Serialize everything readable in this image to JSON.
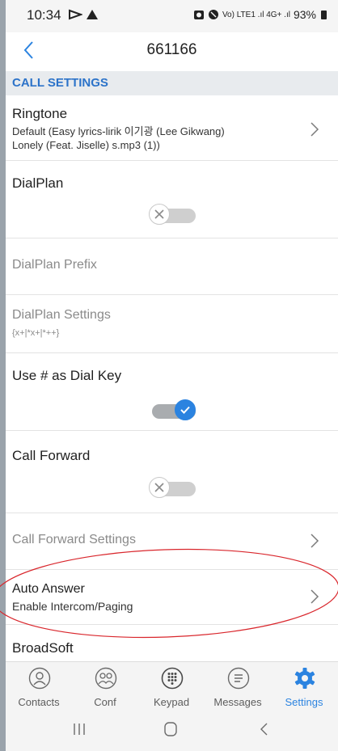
{
  "status_bar": {
    "time": "10:34",
    "right_text": "Vo) LTE1 .ıl 4G+ .ıl",
    "battery": "93%"
  },
  "header": {
    "title": "661166"
  },
  "section": {
    "title": "CALL SETTINGS"
  },
  "settings": {
    "ringtone": {
      "title": "Ringtone",
      "subtitle_line1": "Default (Easy lyrics-lirik 이기광 (Lee Gikwang)",
      "subtitle_line2": "Lonely (Feat. Jiselle) s.mp3 (1))"
    },
    "dialplan": {
      "title": "DialPlan",
      "enabled": false
    },
    "dialplan_prefix": {
      "title": "DialPlan Prefix"
    },
    "dialplan_settings": {
      "title": "DialPlan Settings",
      "value": "{x+|*x+|*++}"
    },
    "use_hash": {
      "title": "Use # as Dial Key",
      "enabled": true
    },
    "call_forward": {
      "title": "Call Forward",
      "enabled": false
    },
    "call_forward_settings": {
      "title": "Call Forward Settings"
    },
    "auto_answer": {
      "title": "Auto Answer",
      "subtitle": "Enable Intercom/Paging"
    },
    "broadsoft": {
      "title": "BroadSoft"
    }
  },
  "tabs": [
    {
      "label": "Contacts",
      "icon": "person-icon",
      "active": false
    },
    {
      "label": "Conf",
      "icon": "group-icon",
      "active": false
    },
    {
      "label": "Keypad",
      "icon": "keypad-icon",
      "active": false
    },
    {
      "label": "Messages",
      "icon": "message-icon",
      "active": false
    },
    {
      "label": "Settings",
      "icon": "gear-icon",
      "active": true
    }
  ],
  "colors": {
    "accent": "#2b83e0",
    "section_title": "#2c73c9",
    "annotation": "#d9262c"
  }
}
